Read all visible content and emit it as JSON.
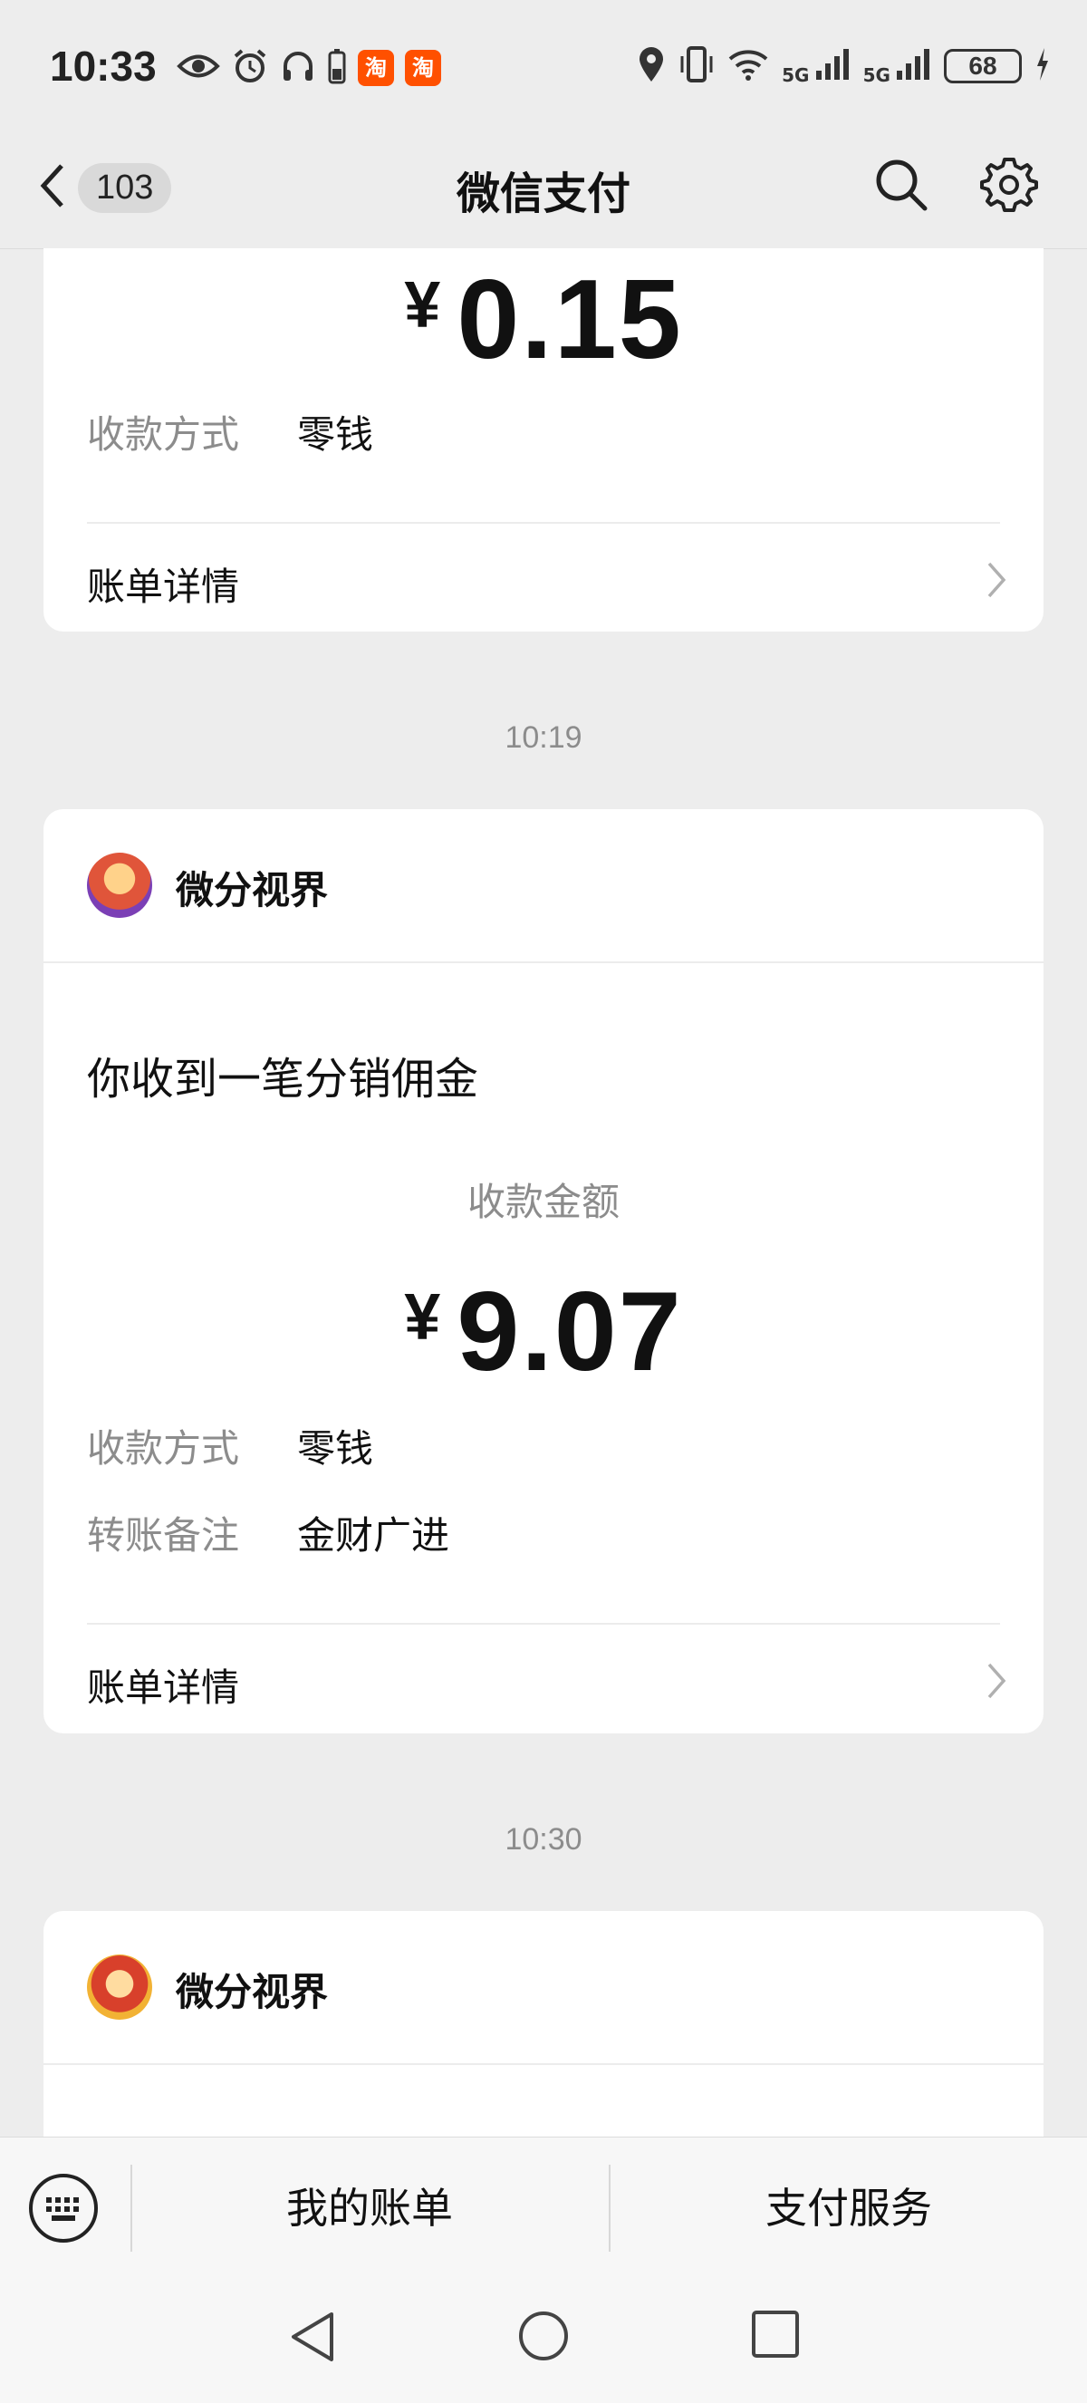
{
  "status_bar": {
    "time": "10:33",
    "taobao_label": "淘",
    "net1": "5G",
    "net2": "5G",
    "battery": "68"
  },
  "header": {
    "back_count": "103",
    "title": "微信支付"
  },
  "messages": [
    {
      "amount_yen": "¥",
      "amount": "0.15",
      "method_label": "收款方式",
      "method_value": "零钱",
      "detail_label": "账单详情"
    },
    {
      "time": "10:19",
      "merchant": "微分视界",
      "title": "你收到一笔分销佣金",
      "amount_label": "收款金额",
      "amount_yen": "¥",
      "amount": "9.07",
      "method_label": "收款方式",
      "method_value": "零钱",
      "note_label": "转账备注",
      "note_value": "金财广进",
      "detail_label": "账单详情"
    },
    {
      "time": "10:30",
      "merchant": "微分视界"
    }
  ],
  "bottom_menu": {
    "my_bill": "我的账单",
    "pay_service": "支付服务"
  },
  "icons": [
    "eye-icon",
    "alarm-icon",
    "headphones-icon",
    "battery-small-icon",
    "taobao-icon",
    "location-icon",
    "vibrate-icon",
    "wifi-icon",
    "signal-icon",
    "charging-icon",
    "search-icon",
    "gear-icon",
    "chevron-right-icon",
    "keyboard-icon",
    "nav-back-icon",
    "nav-home-icon",
    "nav-recents-icon"
  ]
}
